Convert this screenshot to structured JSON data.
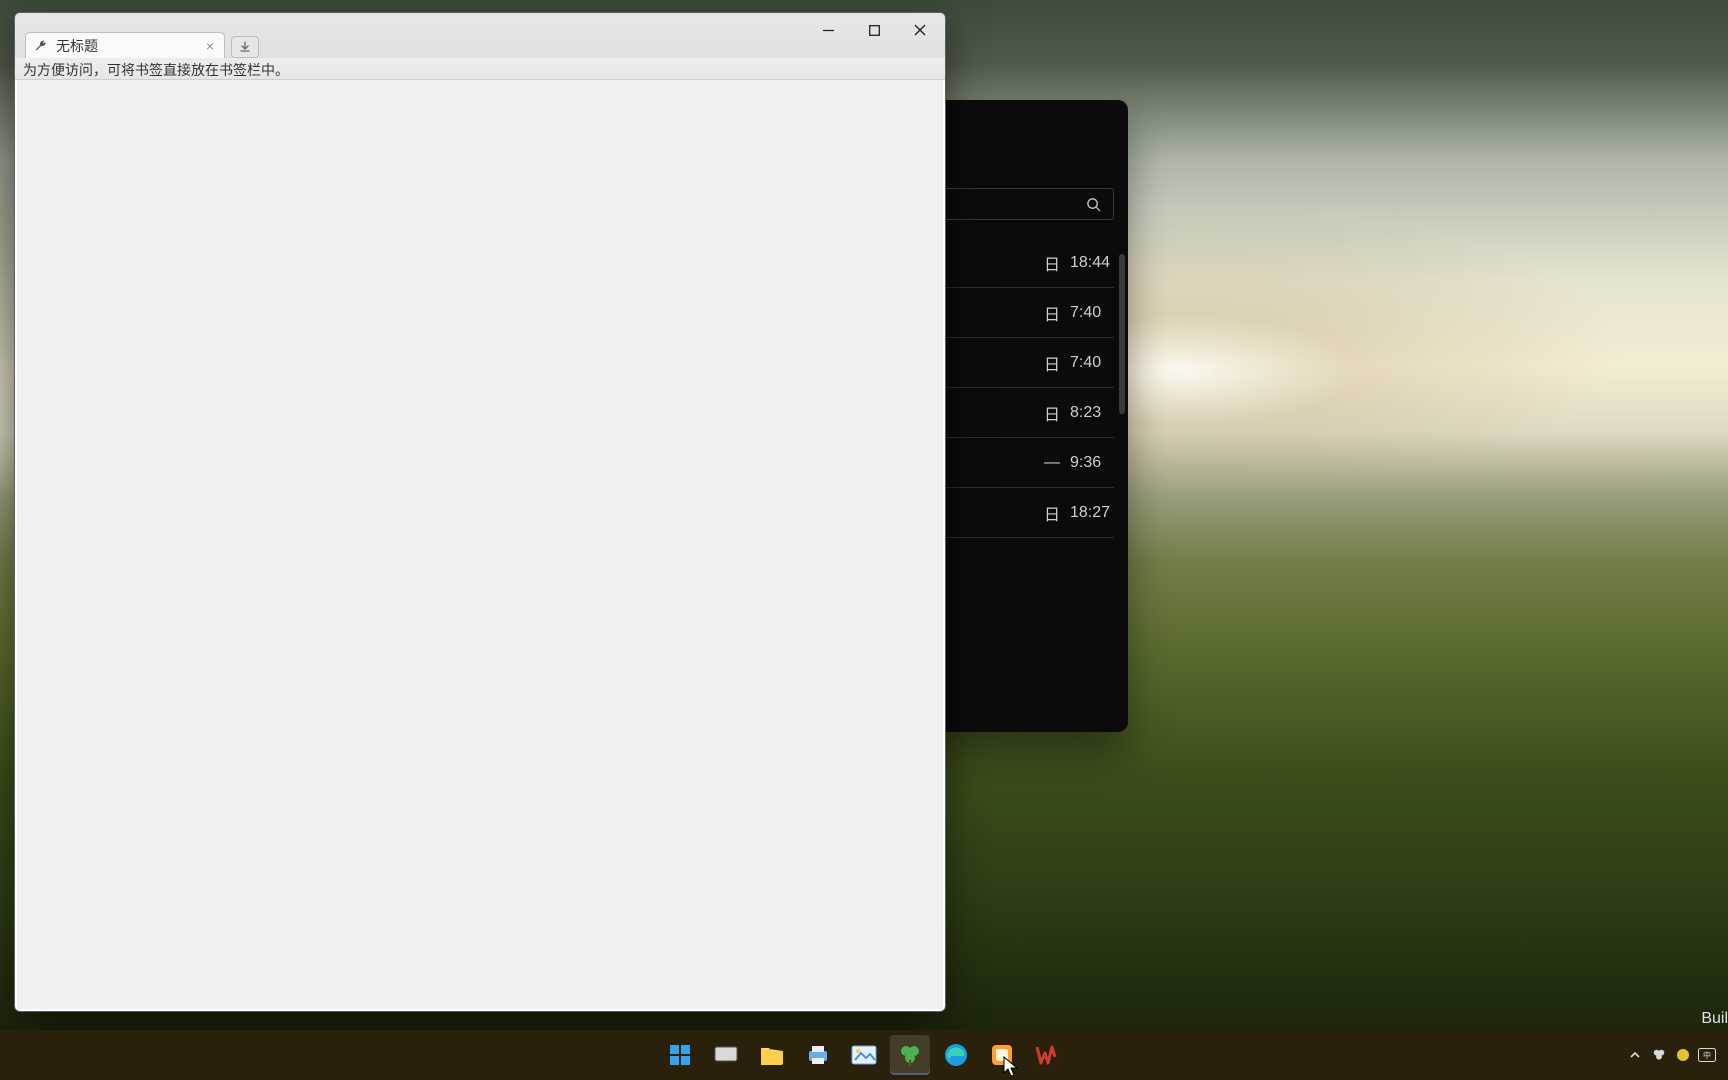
{
  "build_label": "Buil",
  "clover": {
    "tab_title": "无标题",
    "bookmarkbar_hint": "为方便访问，可将书签直接放在书签栏中。"
  },
  "background_list": {
    "rows": [
      {
        "sep": "日",
        "time": "18:44"
      },
      {
        "sep": "日",
        "time": "7:40"
      },
      {
        "sep": "日",
        "time": "7:40"
      },
      {
        "sep": "日",
        "time": "8:23"
      },
      {
        "sep": "—",
        "time": "9:36"
      },
      {
        "sep": "日",
        "time": "18:27"
      }
    ]
  },
  "taskbar": {
    "icons": [
      "start",
      "taskview",
      "file-explorer",
      "printer",
      "photos",
      "clover",
      "edge",
      "app-orange",
      "wps"
    ]
  },
  "colors": {
    "taskbar": "#2a210c",
    "win_bg": "#ffffff",
    "clover_body": "#f0f0f0",
    "dark_panel": "#0b0b0b"
  }
}
